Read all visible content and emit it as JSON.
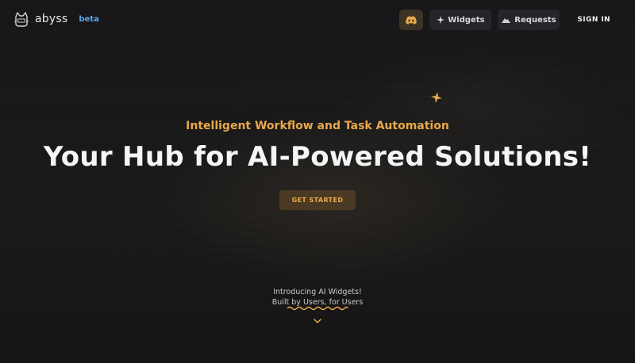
{
  "brand": {
    "name": "abyss",
    "tag": "beta"
  },
  "nav": {
    "discord_icon": "discord-icon",
    "widgets_label": "Widgets",
    "requests_label": "Requests",
    "signin_label": "SIGN IN"
  },
  "hero": {
    "subtitle": "Intelligent Workflow and Task Automation",
    "headline": "Your Hub for AI-Powered Solutions!",
    "cta_label": "GET STARTED"
  },
  "intro": {
    "line1": "Introducing AI Widgets!",
    "line2": "Built by Users, for Users"
  },
  "colors": {
    "accent": "#e9a94a",
    "beta": "#5aa9e6",
    "background": "#19191a"
  }
}
